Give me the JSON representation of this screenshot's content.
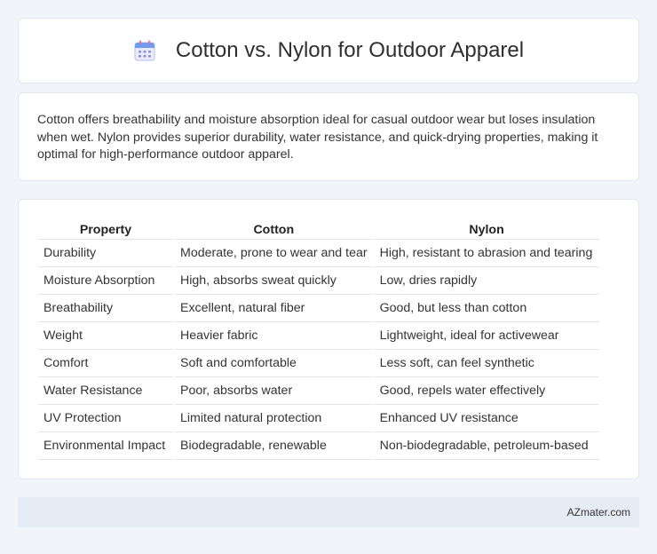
{
  "header": {
    "title": "Cotton vs. Nylon for Outdoor Apparel",
    "icon": "calendar-icon"
  },
  "summary": {
    "text": "Cotton offers breathability and moisture absorption ideal for casual outdoor wear but loses insulation when wet. Nylon provides superior durability, water resistance, and quick-drying properties, making it optimal for high-performance outdoor apparel."
  },
  "table": {
    "headers": [
      "Property",
      "Cotton",
      "Nylon"
    ],
    "rows": [
      [
        "Durability",
        "Moderate, prone to wear and tear",
        "High, resistant to abrasion and tearing"
      ],
      [
        "Moisture Absorption",
        "High, absorbs sweat quickly",
        "Low, dries rapidly"
      ],
      [
        "Breathability",
        "Excellent, natural fiber",
        "Good, but less than cotton"
      ],
      [
        "Weight",
        "Heavier fabric",
        "Lightweight, ideal for activewear"
      ],
      [
        "Comfort",
        "Soft and comfortable",
        "Less soft, can feel synthetic"
      ],
      [
        "Water Resistance",
        "Poor, absorbs water",
        "Good, repels water effectively"
      ],
      [
        "UV Protection",
        "Limited natural protection",
        "Enhanced UV resistance"
      ],
      [
        "Environmental Impact",
        "Biodegradable, renewable",
        "Non-biodegradable, petroleum-based"
      ]
    ]
  },
  "footer": {
    "brand": "AZmater.com"
  },
  "colors": {
    "background": "#f1f4f9",
    "card": "#ffffff",
    "footer": "#e6ecf6",
    "icon_accent": "#7b86e6"
  }
}
